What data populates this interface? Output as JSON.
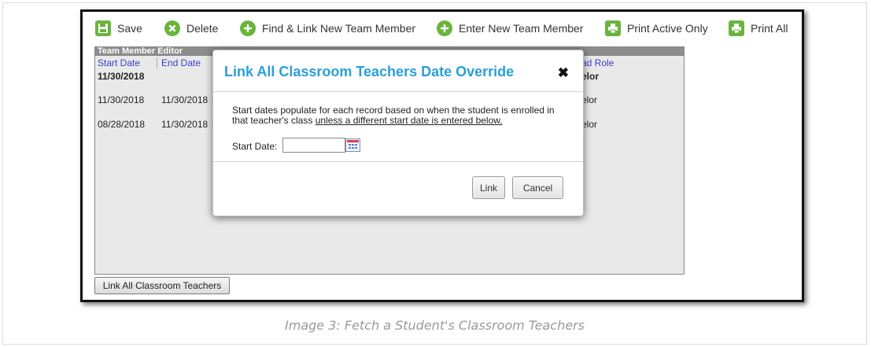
{
  "toolbar": {
    "save_label": "Save",
    "delete_label": "Delete",
    "find_link_label": "Find & Link New Team Member",
    "enter_new_label": "Enter New Team Member",
    "print_active_label": "Print Active Only",
    "print_all_label": "Print All"
  },
  "editor": {
    "header": "Team Member Editor",
    "columns": [
      "Start Date",
      "End Date",
      "ad Role"
    ],
    "rows": [
      {
        "start": "11/30/2018",
        "end": "",
        "role": "elor"
      },
      {
        "start": "11/30/2018",
        "end": "11/30/2018",
        "role": "elor"
      },
      {
        "start": "08/28/2018",
        "end": "11/30/2018",
        "role": "elor"
      }
    ]
  },
  "link_all_button": "Link All Classroom Teachers",
  "modal": {
    "title": "Link All Classroom Teachers Date Override",
    "close": "✖",
    "body_line1": "Start dates populate for each record based on when the student is enrolled in",
    "body_line2_plain": "that teacher's class ",
    "body_line2_underlined": "unless a different start date is entered below.",
    "start_date_label": "Start Date:",
    "start_date_value": "",
    "link_label": "Link",
    "cancel_label": "Cancel"
  },
  "caption": "Image 3: Fetch a Student's Classroom Teachers",
  "colors": {
    "accent_green": "#6ab43e",
    "title_blue": "#2a9fd8",
    "column_blue": "#3c3cd0"
  },
  "icons": [
    "save-icon",
    "delete-icon",
    "add-icon",
    "add-icon",
    "print-icon",
    "print-icon",
    "calendar-icon",
    "close-icon"
  ]
}
